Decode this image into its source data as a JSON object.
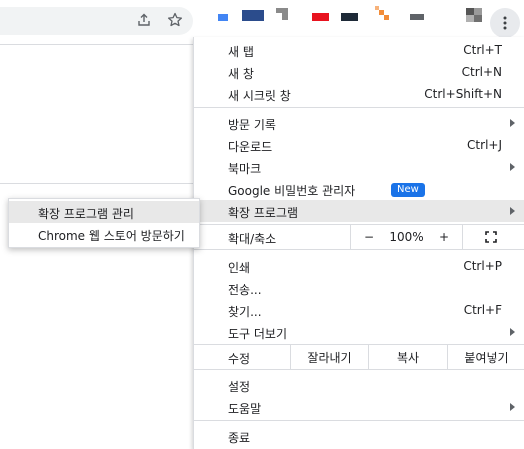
{
  "toolbar": {
    "share_icon": "share-icon",
    "star_icon": "star-icon",
    "menu_icon": "kebab-menu-icon"
  },
  "bookmarks": [
    {
      "name": "bookmark-favicon",
      "color": "#4285f4"
    },
    {
      "name": "bookmark-favicon",
      "color": "#2b4c8c"
    },
    {
      "name": "bookmark-favicon",
      "color": "#8a8a8a"
    },
    {
      "name": "bookmark-favicon",
      "color": "#e8131f"
    },
    {
      "name": "bookmark-favicon",
      "color": "#1e2a38"
    },
    {
      "name": "bookmark-favicon",
      "color": "#f28c38"
    },
    {
      "name": "bookmark-favicon",
      "color": "#5f6368"
    },
    {
      "name": "bookmark-favicon",
      "color": "#555555"
    }
  ],
  "menu": {
    "new_tab": {
      "label": "새 탭",
      "shortcut": "Ctrl+T"
    },
    "new_window": {
      "label": "새 창",
      "shortcut": "Ctrl+N"
    },
    "new_incognito": {
      "label": "새 시크릿 창",
      "shortcut": "Ctrl+Shift+N"
    },
    "history": {
      "label": "방문 기록"
    },
    "downloads": {
      "label": "다운로드",
      "shortcut": "Ctrl+J"
    },
    "bookmarks": {
      "label": "북마크"
    },
    "password_manager": {
      "label": "Google 비밀번호 관리자",
      "badge": "New"
    },
    "extensions": {
      "label": "확장 프로그램"
    },
    "zoom": {
      "label": "확대/축소",
      "minus": "−",
      "value": "100%",
      "plus": "+"
    },
    "print": {
      "label": "인쇄",
      "shortcut": "Ctrl+P"
    },
    "cast": {
      "label": "전송..."
    },
    "find": {
      "label": "찾기...",
      "shortcut": "Ctrl+F"
    },
    "more_tools": {
      "label": "도구 더보기"
    },
    "edit": {
      "label": "수정",
      "cut": "잘라내기",
      "copy": "복사",
      "paste": "붙여넣기"
    },
    "settings": {
      "label": "설정"
    },
    "help": {
      "label": "도움말"
    },
    "exit": {
      "label": "종료"
    }
  },
  "submenu": {
    "manage_extensions": "확장 프로그램 관리",
    "web_store": "Chrome 웹 스토어 방문하기"
  },
  "colors": {
    "highlight": "#e8e8e8",
    "badge": "#1a73e8",
    "separator": "#dadce0"
  }
}
